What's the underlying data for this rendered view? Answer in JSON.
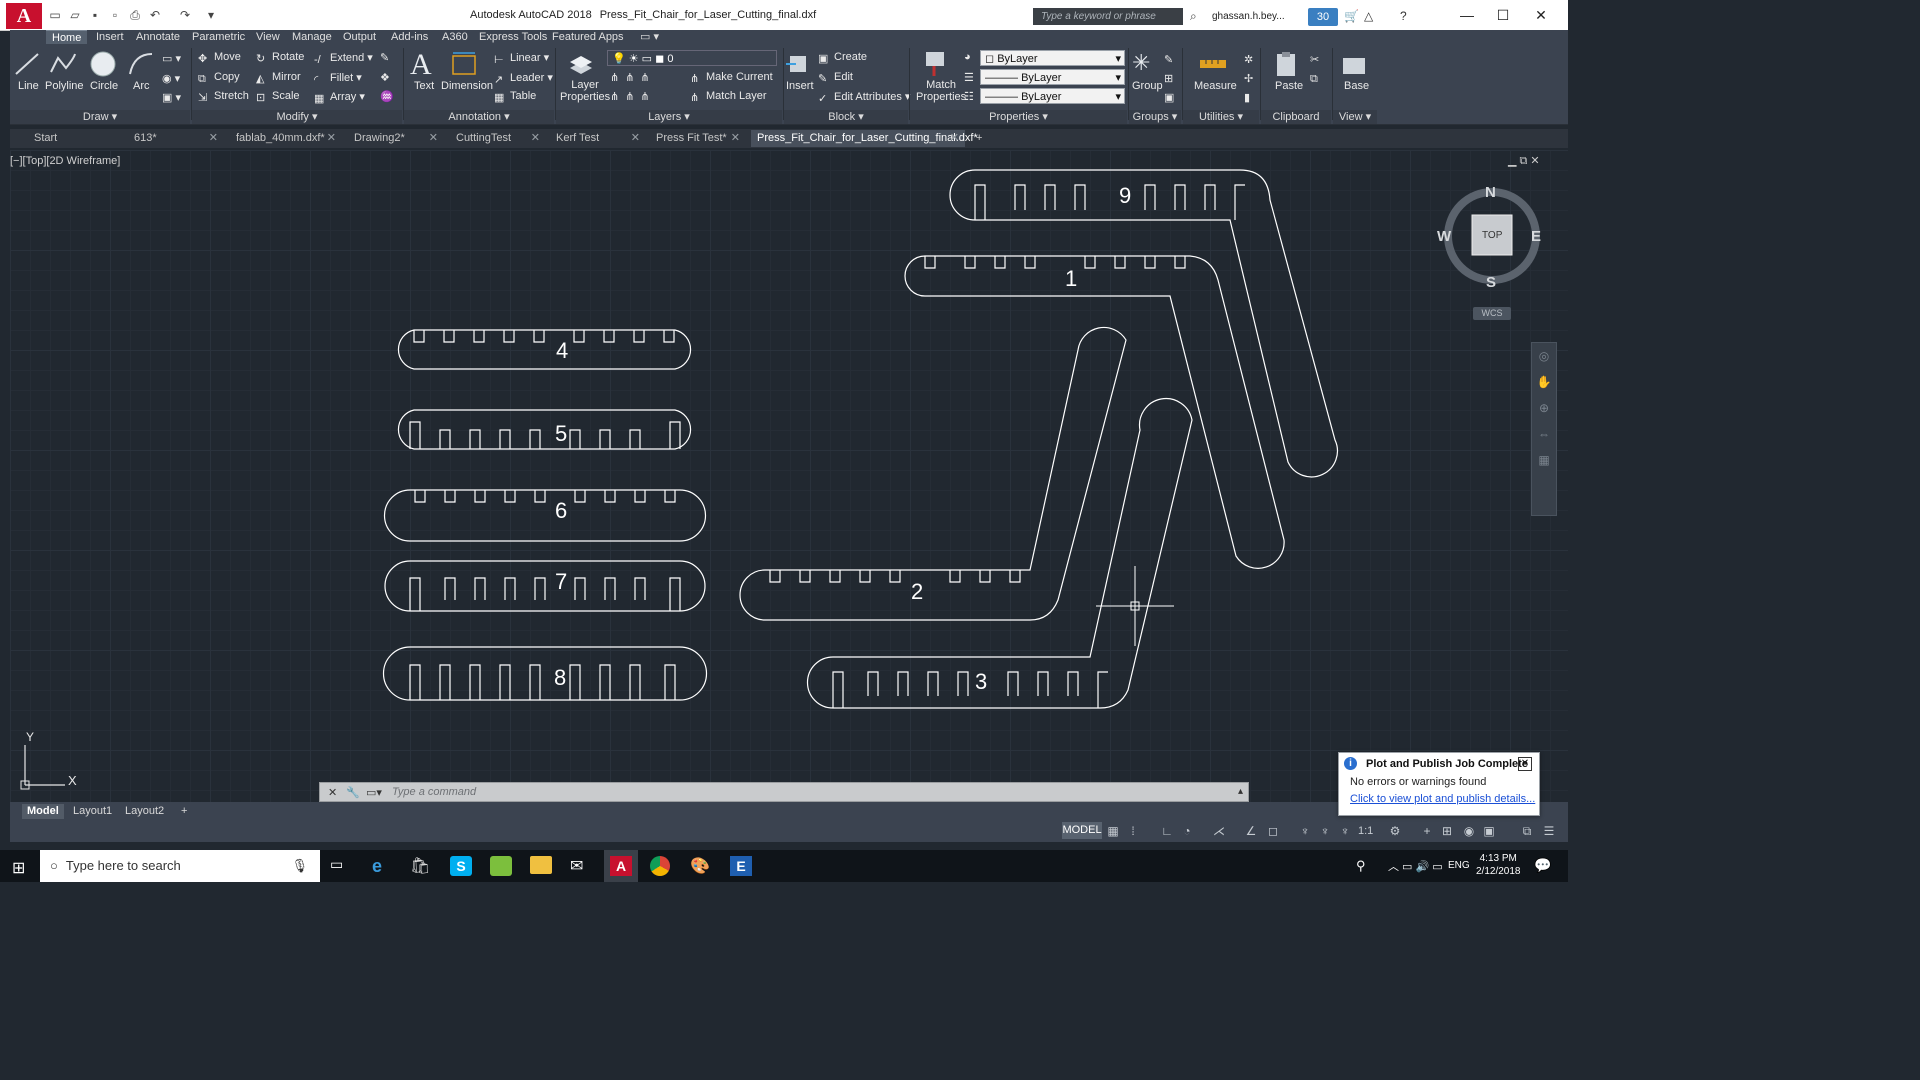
{
  "titlebar": {
    "app_name": "Autodesk AutoCAD 2018",
    "file_name": "Press_Fit_Chair_for_Laser_Cutting_final.dxf",
    "search_placeholder": "Type a keyword or phrase",
    "user": "ghassan.h.bey...",
    "notifications": "30"
  },
  "ribbon_tabs": [
    "Home",
    "Insert",
    "Annotate",
    "Parametric",
    "View",
    "Manage",
    "Output",
    "Add-ins",
    "A360",
    "Express Tools",
    "Featured Apps"
  ],
  "ribbon": {
    "draw": {
      "line": "Line",
      "polyline": "Polyline",
      "circle": "Circle",
      "arc": "Arc",
      "label": "Draw"
    },
    "modify": {
      "move": "Move",
      "rotate": "Rotate",
      "extend": "Extend",
      "copy": "Copy",
      "mirror": "Mirror",
      "fillet": "Fillet",
      "stretch": "Stretch",
      "scale": "Scale",
      "array": "Array",
      "label": "Modify"
    },
    "annotation": {
      "text": "Text",
      "dimension": "Dimension",
      "linear": "Linear",
      "leader": "Leader",
      "table": "Table",
      "label": "Annotation"
    },
    "layers": {
      "layer_properties": "Layer\nProperties",
      "layer_value": "0",
      "make_current": "Make Current",
      "match_layer": "Match Layer",
      "label": "Layers"
    },
    "block": {
      "insert": "Insert",
      "create": "Create",
      "edit": "Edit",
      "edit_attributes": "Edit Attributes",
      "label": "Block"
    },
    "properties": {
      "match": "Match\nProperties",
      "color": "ByLayer",
      "linetype": "ByLayer",
      "lineweight": "ByLayer",
      "label": "Properties"
    },
    "groups": {
      "group": "Group",
      "label": "Groups"
    },
    "utilities": {
      "measure": "Measure",
      "label": "Utilities"
    },
    "clipboard": {
      "paste": "Paste",
      "label": "Clipboard"
    },
    "view": {
      "base": "Base",
      "label": "View"
    }
  },
  "doc_tabs": [
    "Start",
    "613*",
    "fablab_40mm.dxf*",
    "Drawing2*",
    "CuttingTest",
    "Kerf Test",
    "Press Fit Test*",
    "Press_Fit_Chair_for_Laser_Cutting_final.dxf*"
  ],
  "viewport_label": "[−][Top][2D Wireframe]",
  "viewcube": {
    "n": "N",
    "s": "S",
    "e": "E",
    "w": "W",
    "face": "TOP",
    "wcs": "WCS"
  },
  "drawing_labels": [
    "1",
    "2",
    "3",
    "4",
    "5",
    "6",
    "7",
    "8",
    "9"
  ],
  "ucs": {
    "x": "X",
    "y": "Y"
  },
  "command_placeholder": "Type a command",
  "layout_tabs": [
    "Model",
    "Layout1",
    "Layout2"
  ],
  "status": {
    "model": "MODEL",
    "scale": "1:1"
  },
  "notification": {
    "title": "Plot and Publish Job Complete",
    "message": "No errors or warnings found",
    "link": "Click to view plot and publish details..."
  },
  "taskbar": {
    "search": "Type here to search",
    "lang": "ENG",
    "time": "4:13 PM",
    "date": "2/12/2018"
  }
}
